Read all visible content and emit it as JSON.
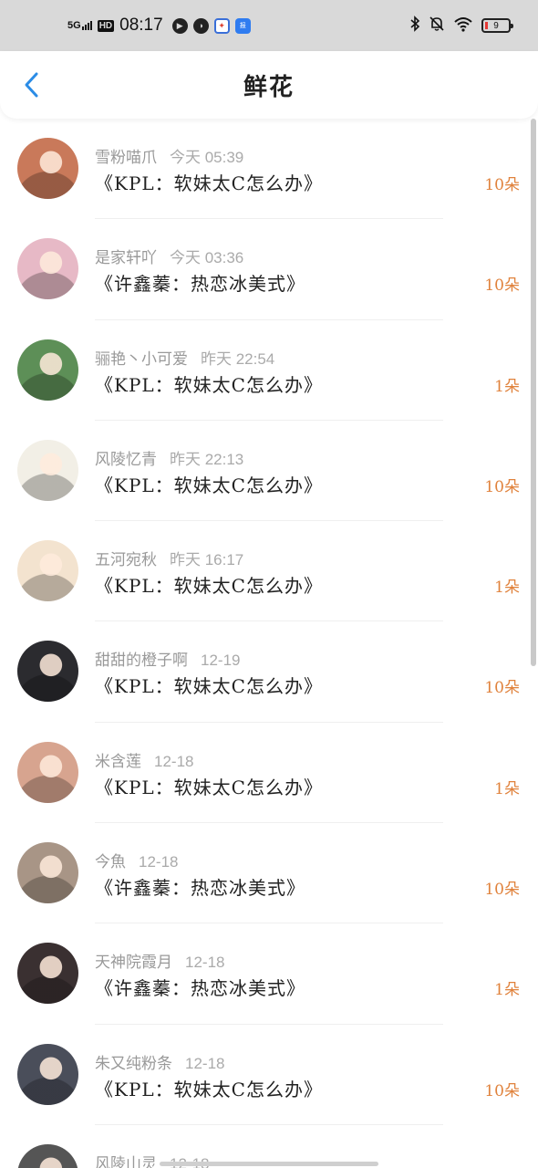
{
  "status_bar": {
    "network": "5G",
    "hd": "HD",
    "time": "08:17",
    "battery": "9",
    "app_icons": [
      "play-icon",
      "compass-icon",
      "game-icon",
      "news-icon"
    ],
    "right_icons": [
      "bluetooth-icon",
      "mute-icon",
      "wifi-icon",
      "battery-icon"
    ],
    "apps": [
      "▶",
      "◑",
      "✦",
      "报"
    ]
  },
  "header": {
    "title": "鲜花",
    "back_icon": "chevron-left-icon",
    "accent": "#2b8ce6"
  },
  "colors": {
    "gift": "#e0823c",
    "name": "#999999"
  },
  "items": [
    {
      "name": "雪粉喵爪",
      "time": "今天 05:39",
      "topic": "《KPL：软妹太C怎么办》",
      "gift": "10朵",
      "avatar_bg": "#c9795a"
    },
    {
      "name": "是家轩吖",
      "time": "今天 03:36",
      "topic": "《许鑫蓁：热恋冰美式》",
      "gift": "10朵",
      "avatar_bg": "#e7b9c6"
    },
    {
      "name": "骊艳丶小可爱",
      "time": "昨天 22:54",
      "topic": "《KPL：软妹太C怎么办》",
      "gift": "1朵",
      "avatar_bg": "#5d8f57"
    },
    {
      "name": "风陵忆青",
      "time": "昨天 22:13",
      "topic": "《KPL：软妹太C怎么办》",
      "gift": "10朵",
      "avatar_bg": "#f2efe6"
    },
    {
      "name": "五河宛秋",
      "time": "昨天 16:17",
      "topic": "《KPL：软妹太C怎么办》",
      "gift": "1朵",
      "avatar_bg": "#f3e3cf"
    },
    {
      "name": "甜甜的橙子啊",
      "time": "12-19",
      "topic": "《KPL：软妹太C怎么办》",
      "gift": "10朵",
      "avatar_bg": "#2b2b2f"
    },
    {
      "name": "米含莲",
      "time": "12-18",
      "topic": "《KPL：软妹太C怎么办》",
      "gift": "1朵",
      "avatar_bg": "#d7a48f"
    },
    {
      "name": "今魚",
      "time": "12-18",
      "topic": "《许鑫蓁：热恋冰美式》",
      "gift": "10朵",
      "avatar_bg": "#a89586"
    },
    {
      "name": "天神院霞月",
      "time": "12-18",
      "topic": "《许鑫蓁：热恋冰美式》",
      "gift": "1朵",
      "avatar_bg": "#3a3031"
    },
    {
      "name": "朱又纯粉条",
      "time": "12-18",
      "topic": "《KPL：软妹太C怎么办》",
      "gift": "10朵",
      "avatar_bg": "#4a4e5a"
    },
    {
      "name": "风陵山灵",
      "time": "12-18",
      "topic": "",
      "gift": "",
      "avatar_bg": "#555555"
    }
  ]
}
